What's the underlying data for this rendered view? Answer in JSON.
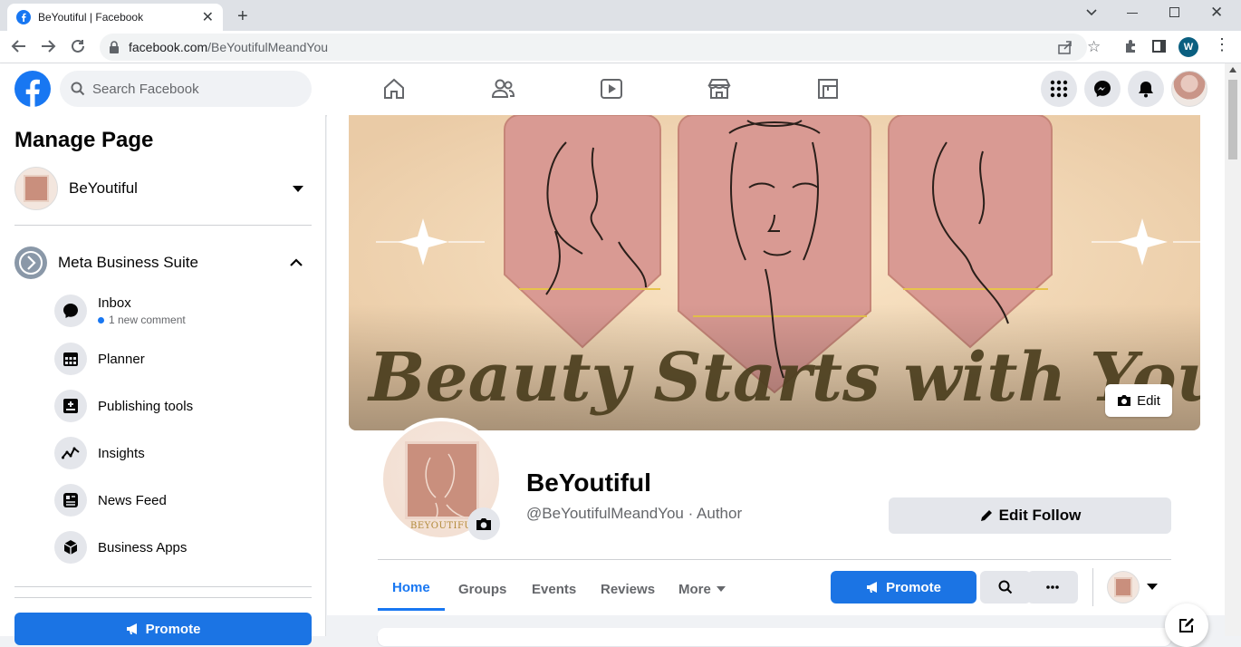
{
  "browser": {
    "tab_title": "BeYoutiful | Facebook",
    "url_domain": "facebook.com",
    "url_path": "/BeYoutifulMeandYou",
    "icons": [
      "facebook-favicon",
      "close-icon",
      "plus-icon",
      "back-icon",
      "forward-icon",
      "reload-icon",
      "lock-icon",
      "share-icon",
      "star-icon",
      "extensions-icon",
      "sidepanel-icon",
      "profile-icon",
      "menu-icon",
      "minimize-icon",
      "restore-icon",
      "window-close-icon",
      "tab-search-icon"
    ]
  },
  "header": {
    "search_placeholder": "Search Facebook",
    "nav_icons": [
      "home-icon",
      "friends-icon",
      "watch-icon",
      "marketplace-icon",
      "gaming-icon"
    ],
    "right_icons": [
      "menu-grid-icon",
      "messenger-icon",
      "notifications-icon",
      "account-avatar"
    ]
  },
  "sidebar": {
    "title": "Manage Page",
    "page_name": "BeYoutiful",
    "suite_label": "Meta Business Suite",
    "items": [
      {
        "label": "Inbox",
        "sub": "1 new comment",
        "icon": "chat-icon"
      },
      {
        "label": "Planner",
        "icon": "calendar-icon"
      },
      {
        "label": "Publishing tools",
        "icon": "publishing-icon"
      },
      {
        "label": "Insights",
        "icon": "insights-icon"
      },
      {
        "label": "News Feed",
        "icon": "newsfeed-icon"
      },
      {
        "label": "Business Apps",
        "icon": "cube-icon"
      }
    ],
    "promote_label": "Promote"
  },
  "cover": {
    "text": "Beauty Starts with Yourself",
    "edit_label": "Edit"
  },
  "profile": {
    "logo_text": "BEYOUTIFUL",
    "name": "BeYoutiful",
    "handle": "@BeYoutifulMeandYou · Author",
    "edit_follow_label": "Edit Follow"
  },
  "tabs": {
    "items": [
      "Home",
      "Groups",
      "Events",
      "Reviews",
      "More"
    ],
    "active": "Home",
    "promote_label": "Promote"
  },
  "colors": {
    "fb_blue": "#1877f2",
    "button_blue": "#1b74e4",
    "grey_button": "#e4e6eb",
    "page_bg": "#f0f2f5"
  }
}
